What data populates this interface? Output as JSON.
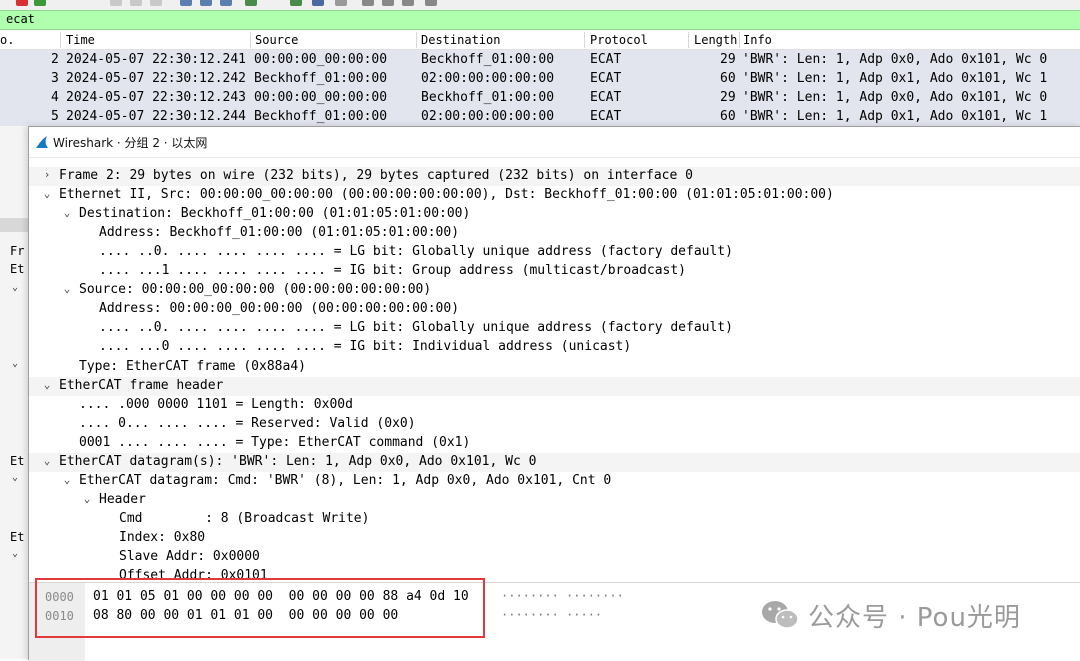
{
  "filter": {
    "value": "ecat"
  },
  "packet_list": {
    "columns": [
      "o.",
      "Time",
      "Source",
      "Destination",
      "Protocol",
      "Length",
      "Info"
    ],
    "rows": [
      {
        "no": "2",
        "time": "2024-05-07 22:30:12.241",
        "source": "00:00:00_00:00:00",
        "destination": "Beckhoff_01:00:00",
        "protocol": "ECAT",
        "length": "29",
        "info": "'BWR': Len: 1, Adp 0x0, Ado 0x101, Wc 0"
      },
      {
        "no": "3",
        "time": "2024-05-07 22:30:12.242",
        "source": "Beckhoff_01:00:00",
        "destination": "02:00:00:00:00:00",
        "protocol": "ECAT",
        "length": "60",
        "info": "'BWR': Len: 1, Adp 0x1, Ado 0x101, Wc 1"
      },
      {
        "no": "4",
        "time": "2024-05-07 22:30:12.243",
        "source": "00:00:00_00:00:00",
        "destination": "Beckhoff_01:00:00",
        "protocol": "ECAT",
        "length": "29",
        "info": "'BWR': Len: 1, Adp 0x0, Ado 0x101, Wc 0"
      },
      {
        "no": "5",
        "time": "2024-05-07 22:30:12.244",
        "source": "Beckhoff_01:00:00",
        "destination": "02:00:00:00:00:00",
        "protocol": "ECAT",
        "length": "60",
        "info": "'BWR': Len: 1, Adp 0x1, Ado 0x101, Wc 1"
      }
    ]
  },
  "left_pane": {
    "labels": [
      "Fr",
      "Et",
      "Et",
      "Et"
    ]
  },
  "dialog": {
    "title": "Wireshark · 分组 2 · 以太网",
    "tree": [
      {
        "arrow": "›",
        "text": "Frame 2: 29 bytes on wire (232 bits), 29 bytes captured (232 bits) on interface 0"
      },
      {
        "arrow": "⌄",
        "text": "Ethernet II, Src: 00:00:00_00:00:00 (00:00:00:00:00:00), Dst: Beckhoff_01:00:00 (01:01:05:01:00:00)"
      },
      {
        "arrow": "⌄",
        "text": "Destination: Beckhoff_01:00:00 (01:01:05:01:00:00)"
      },
      {
        "arrow": "",
        "text": "Address: Beckhoff_01:00:00 (01:01:05:01:00:00)"
      },
      {
        "arrow": "",
        "text": ".... ..0. .... .... .... .... = LG bit: Globally unique address (factory default)"
      },
      {
        "arrow": "",
        "text": ".... ...1 .... .... .... .... = IG bit: Group address (multicast/broadcast)"
      },
      {
        "arrow": "⌄",
        "text": "Source: 00:00:00_00:00:00 (00:00:00:00:00:00)"
      },
      {
        "arrow": "",
        "text": "Address: 00:00:00_00:00:00 (00:00:00:00:00:00)"
      },
      {
        "arrow": "",
        "text": ".... ..0. .... .... .... .... = LG bit: Globally unique address (factory default)"
      },
      {
        "arrow": "",
        "text": ".... ...0 .... .... .... .... = IG bit: Individual address (unicast)"
      },
      {
        "arrow": "",
        "text": "Type: EtherCAT frame (0x88a4)"
      },
      {
        "arrow": "⌄",
        "text": "EtherCAT frame header"
      },
      {
        "arrow": "",
        "text": ".... .000 0000 1101 = Length: 0x00d"
      },
      {
        "arrow": "",
        "text": ".... 0... .... .... = Reserved: Valid (0x0)"
      },
      {
        "arrow": "",
        "text": "0001 .... .... .... = Type: EtherCAT command (0x1)"
      },
      {
        "arrow": "⌄",
        "text": "EtherCAT datagram(s): 'BWR': Len: 1, Adp 0x0, Ado 0x101, Wc 0"
      },
      {
        "arrow": "⌄",
        "text": "EtherCAT datagram: Cmd: 'BWR' (8), Len: 1, Adp 0x0, Ado 0x101, Cnt 0"
      },
      {
        "arrow": "⌄",
        "text": "Header"
      },
      {
        "arrow": "",
        "text": "Cmd        : 8 (Broadcast Write)"
      },
      {
        "arrow": "",
        "text": "Index: 0x80"
      },
      {
        "arrow": "",
        "text": "Slave Addr: 0x0000"
      },
      {
        "arrow": "",
        "text": "Offset Addr: 0x0101"
      }
    ],
    "hex": [
      {
        "offset": "0000",
        "bytes": "01 01 05 01 00 00 00 00  00 00 00 00 88 a4 0d 10",
        "ascii": "········ ········"
      },
      {
        "offset": "0010",
        "bytes": "08 80 00 00 01 01 01 00  00 00 00 00 00",
        "ascii": "········ ·····"
      }
    ]
  },
  "watermark": {
    "text": "公众号 · Pou光明"
  },
  "colors": {
    "filter_bg": "#afffaf",
    "row_bg": "#e2e5ee",
    "highlight_box": "#e03a3a"
  }
}
